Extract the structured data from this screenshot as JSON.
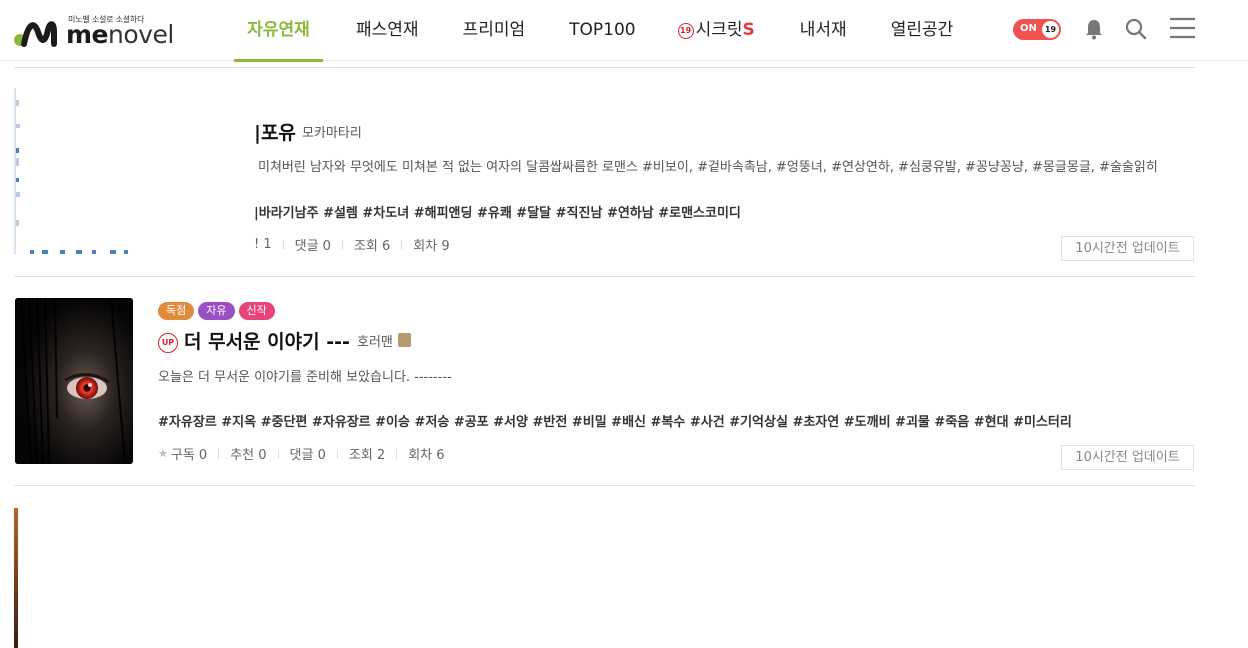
{
  "logo": {
    "tagline": "미노벨 소설로 소셜하다",
    "word_me": "me",
    "word_novel": "novel"
  },
  "nav": {
    "items": [
      {
        "label": "자유연재"
      },
      {
        "label": "패스연재"
      },
      {
        "label": "프리미엄"
      },
      {
        "label": "TOP100"
      },
      {
        "label": "시크릿",
        "badge": "19",
        "suffix": "S"
      },
      {
        "label": "내서재"
      },
      {
        "label": "열린공간"
      }
    ]
  },
  "header": {
    "toggle_label": "ON",
    "toggle_badge": "19"
  },
  "colors": {
    "accent": "#8cb83d",
    "badge_exclusive": "#e08a3c",
    "badge_free": "#9a4fc4",
    "badge_new": "#e9437d",
    "toggle": "#f0534f"
  },
  "icons": [
    "bell-icon",
    "search-icon",
    "menu-icon"
  ],
  "novels": [
    {
      "title": "|포유",
      "author": "모카마타리",
      "description": "미쳐버린 남자와 무엇에도 미쳐본 적 없는 여자의 달콤쌉싸름한 로맨스 #비보이, #겉바속촉남, #엉뚱녀, #연상연하, #심쿵유발, #꽁냥꽁냥, #몽글몽글, #술술읽히",
      "tags": "|바라기남주 #설렘 #차도녀 #해피앤딩 #유쾌 #달달 #직진남 #연하남 #로맨스코미디",
      "stats": {
        "partial": "! 1",
        "comments": "댓글 0",
        "views": "조회 6",
        "episodes": "회차 9"
      },
      "update": "10시간전 업데이트"
    },
    {
      "badges": [
        "독점",
        "자유",
        "신작"
      ],
      "up_label": "UP",
      "title": "더 무서운 이야기 ---",
      "author": "호러맨",
      "description": "오늘은 더 무서운 이야기를 준비해 보았습니다. --------",
      "tags": "#자유장르 #지옥 #중단편 #자유장르 #이승 #저승 #공포 #서양 #반전 #비밀 #배신 #복수 #사건 #기억상실 #초자연 #도깨비 #괴물 #죽음 #현대 #미스터리",
      "stats": {
        "subscribe": "구독 0",
        "recommend": "추천 0",
        "comments": "댓글 0",
        "views": "조회 2",
        "episodes": "회차 6"
      },
      "update": "10시간전 업데이트"
    }
  ]
}
